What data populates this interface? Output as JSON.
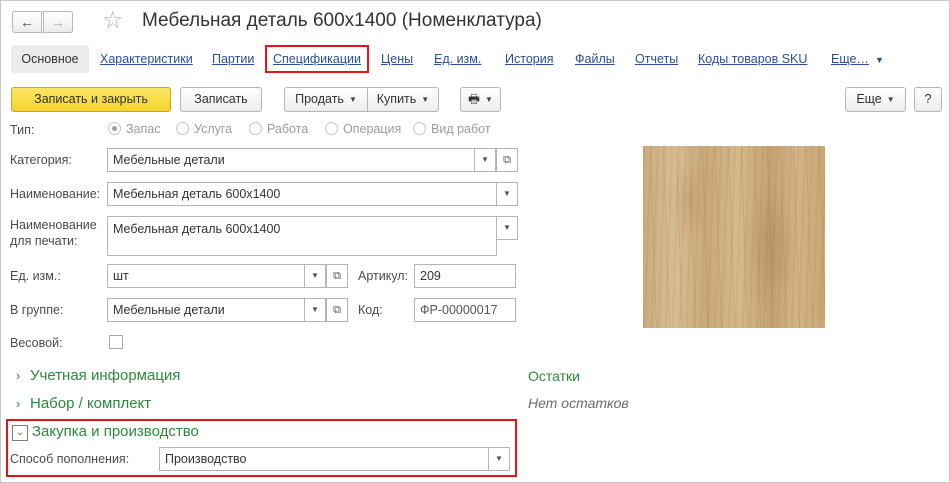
{
  "window": {
    "title": "Мебельная деталь 600x1400 (Номенклатура)",
    "back_icon": "←",
    "forward_icon": "→",
    "star_icon": "☆"
  },
  "tabs": [
    {
      "label": "Основное",
      "active": true
    },
    {
      "label": "Характеристики"
    },
    {
      "label": "Партии"
    },
    {
      "label": "Спецификации",
      "highlighted": true
    },
    {
      "label": "Цены"
    },
    {
      "label": "Ед. изм."
    },
    {
      "label": "История"
    },
    {
      "label": "Файлы"
    },
    {
      "label": "Отчеты"
    },
    {
      "label": "Коды товаров SKU"
    },
    {
      "label": "Еще…"
    }
  ],
  "toolbar": {
    "save_close_label": "Записать и закрыть",
    "save_label": "Записать",
    "sell_label": "Продать",
    "buy_label": "Купить",
    "print_icon": "🖶",
    "more_label": "Еще",
    "help_label": "?"
  },
  "form": {
    "type_label": "Тип:",
    "type_options": [
      "Запас",
      "Услуга",
      "Работа",
      "Операция",
      "Вид работ"
    ],
    "type_selected": "Запас",
    "category_label": "Категория:",
    "category_value": "Мебельные детали",
    "name_label": "Наименование:",
    "name_value": "Мебельная деталь 600x1400",
    "print_name_label_1": "Наименование",
    "print_name_label_2": "для печати:",
    "print_name_value": "Мебельная деталь 600x1400",
    "unit_label": "Ед. изм.:",
    "unit_value": "шт",
    "article_label": "Артикул:",
    "article_value": "209",
    "group_label": "В группе:",
    "group_value": "Мебельные детали",
    "code_label": "Код:",
    "code_value": "ФР-00000017",
    "weight_label": "Весовой:",
    "weight_checked": false
  },
  "groups": {
    "accounting": "Учетная информация",
    "kit": "Набор / комплект",
    "purchase": "Закупка и производство"
  },
  "replenishment": {
    "label": "Способ пополнения:",
    "value": "Производство"
  },
  "stock": {
    "title": "Остатки",
    "empty_text": "Нет остатков"
  },
  "icons": {
    "dropdown": "▼",
    "open": "⧉",
    "chevron_right": "›",
    "chevron_down": "⌄"
  },
  "colors": {
    "accent_green": "#2a8a3c",
    "link_blue": "#2a4f96",
    "primary_yellow": "#f4d12b",
    "highlight_red": "#e0161b"
  }
}
